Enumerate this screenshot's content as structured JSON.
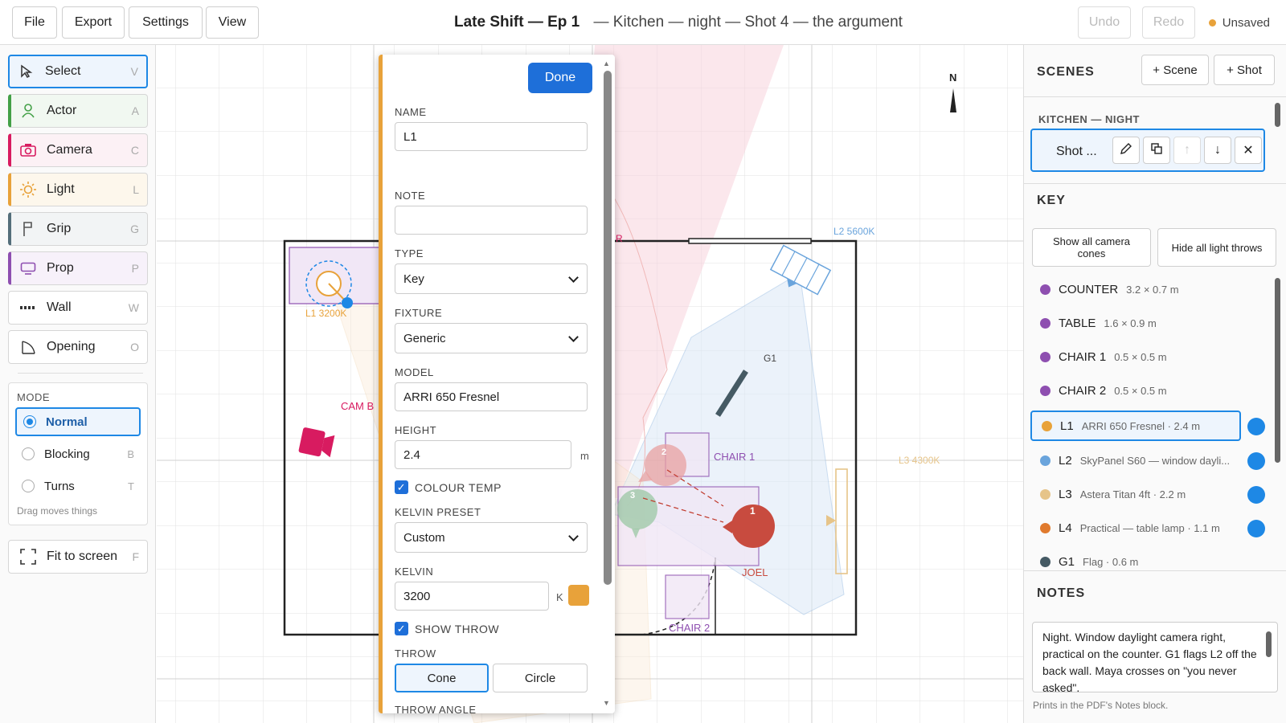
{
  "topbar": {
    "file": "File",
    "export": "Export",
    "settings": "Settings",
    "view": "View",
    "title_bold": "Late Shift — Ep 1",
    "title_rest": "— Kitchen — night — Shot 4 — the argument",
    "undo": "Undo",
    "redo": "Redo",
    "status": "Unsaved",
    "status_color": "#e8a23a"
  },
  "tools": [
    {
      "label": "Select",
      "key": "V"
    },
    {
      "label": "Actor",
      "key": "A"
    },
    {
      "label": "Camera",
      "key": "C"
    },
    {
      "label": "Light",
      "key": "L"
    },
    {
      "label": "Grip",
      "key": "G"
    },
    {
      "label": "Prop",
      "key": "P"
    },
    {
      "label": "Wall",
      "key": "W"
    },
    {
      "label": "Opening",
      "key": "O"
    }
  ],
  "mode": {
    "label": "MODE",
    "options": [
      {
        "label": "Normal",
        "key": ""
      },
      {
        "label": "Blocking",
        "key": "B"
      },
      {
        "label": "Turns",
        "key": "T"
      }
    ],
    "hint": "Drag moves things"
  },
  "fit": {
    "label": "Fit to screen",
    "key": "F"
  },
  "canvas": {
    "north": "N",
    "l1": "L1 3200K",
    "l2": "L2 5600K",
    "l3": "L3 4300K",
    "g1": "G1",
    "camb": "CAM B",
    "chair1": "CHAIR 1",
    "chair2": "CHAIR 2",
    "joel": "JOEL",
    "a1": "1",
    "a2": "2",
    "a3": "3",
    "r": "R"
  },
  "form": {
    "done": "Done",
    "name_label": "NAME",
    "name_value": "L1",
    "note_label": "NOTE",
    "note_value": "",
    "type_label": "TYPE",
    "type_value": "Key",
    "fixture_label": "FIXTURE",
    "fixture_value": "Generic",
    "model_label": "MODEL",
    "model_value": "ARRI 650 Fresnel",
    "height_label": "HEIGHT",
    "height_value": "2.4",
    "height_unit": "m",
    "colour_temp": "COLOUR TEMP",
    "kelvin_preset_label": "KELVIN PRESET",
    "kelvin_preset_value": "Custom",
    "kelvin_label": "KELVIN",
    "kelvin_value": "3200",
    "kelvin_unit": "K",
    "kelvin_swatch": "#e8a23a",
    "show_throw": "SHOW THROW",
    "throw_label": "THROW",
    "throw_cone": "Cone",
    "throw_circle": "Circle",
    "throw_angle_label": "THROW ANGLE"
  },
  "scenes": {
    "header": "SCENES",
    "add_scene": "+ Scene",
    "add_shot": "+ Shot",
    "group": "KITCHEN — NIGHT",
    "shot": "Shot ..."
  },
  "key": {
    "header": "KEY",
    "show_cones": "Show all camera cones",
    "hide_throws": "Hide all light throws",
    "items": [
      {
        "name": "COUNTER",
        "desc": "3.2 × 0.7 m",
        "color": "#8e4fb0"
      },
      {
        "name": "TABLE",
        "desc": "1.6 × 0.9 m",
        "color": "#8e4fb0"
      },
      {
        "name": "CHAIR 1",
        "desc": "0.5 × 0.5 m",
        "color": "#8e4fb0"
      },
      {
        "name": "CHAIR 2",
        "desc": "0.5 × 0.5 m",
        "color": "#8e4fb0"
      },
      {
        "name": "L1",
        "desc": "ARRI 650 Fresnel · 2.4 m",
        "color": "#e8a23a"
      },
      {
        "name": "L2",
        "desc": "SkyPanel S60 — window dayli...",
        "color": "#6aa4dc"
      },
      {
        "name": "L3",
        "desc": "Astera Titan 4ft · 2.2 m",
        "color": "#e6c489"
      },
      {
        "name": "L4",
        "desc": "Practical — table lamp · 1.1 m",
        "color": "#e07a2e"
      },
      {
        "name": "G1",
        "desc": "Flag · 0.6 m",
        "color": "#455a64"
      }
    ]
  },
  "notes": {
    "header": "NOTES",
    "text": "Night. Window daylight camera right, practical on the counter. G1 flags L2 off the back wall. Maya crosses on \"you never asked\".",
    "hint": "Prints in the PDF's Notes block."
  }
}
